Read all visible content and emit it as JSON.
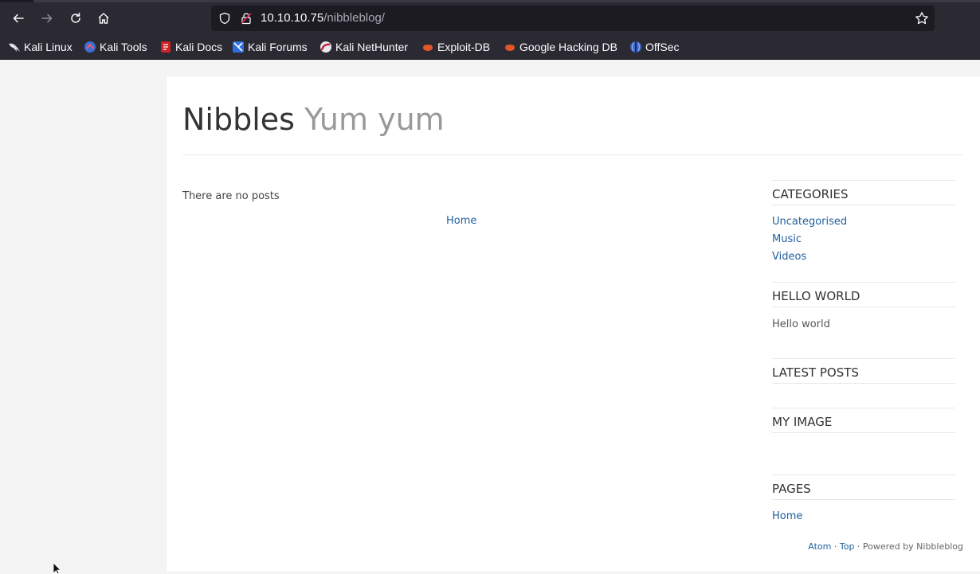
{
  "browser": {
    "url_host": "10.10.10.75",
    "url_path": "/nibbleblog/",
    "bookmarks": [
      {
        "label": "Kali Linux",
        "icon": "kali-dragon-icon"
      },
      {
        "label": "Kali Tools",
        "icon": "kali-tools-icon"
      },
      {
        "label": "Kali Docs",
        "icon": "kali-docs-icon"
      },
      {
        "label": "Kali Forums",
        "icon": "kali-forums-icon"
      },
      {
        "label": "Kali NetHunter",
        "icon": "kali-nethunter-icon"
      },
      {
        "label": "Exploit-DB",
        "icon": "exploit-db-icon"
      },
      {
        "label": "Google Hacking DB",
        "icon": "google-hacking-db-icon"
      },
      {
        "label": "OffSec",
        "icon": "offsec-icon"
      }
    ]
  },
  "blog": {
    "name": "Nibbles",
    "slogan": "Yum yum",
    "no_posts": "There are no posts",
    "home_link": "Home"
  },
  "sidebar": {
    "categories_title": "CATEGORIES",
    "categories": [
      "Uncategorised",
      "Music",
      "Videos"
    ],
    "hello_title": "HELLO WORLD",
    "hello_text": "Hello world",
    "latest_title": "LATEST POSTS",
    "image_title": "MY IMAGE",
    "pages_title": "PAGES",
    "pages": [
      "Home"
    ]
  },
  "footer": {
    "atom": "Atom",
    "sep1": " · ",
    "top": "Top",
    "powered": " · Powered by Nibbleblog"
  },
  "colors": {
    "chrome_bg": "#2b2a33",
    "urlbar_bg": "#1c1b22",
    "link": "#1f5f9e",
    "page_bg": "#f4f4f4"
  }
}
